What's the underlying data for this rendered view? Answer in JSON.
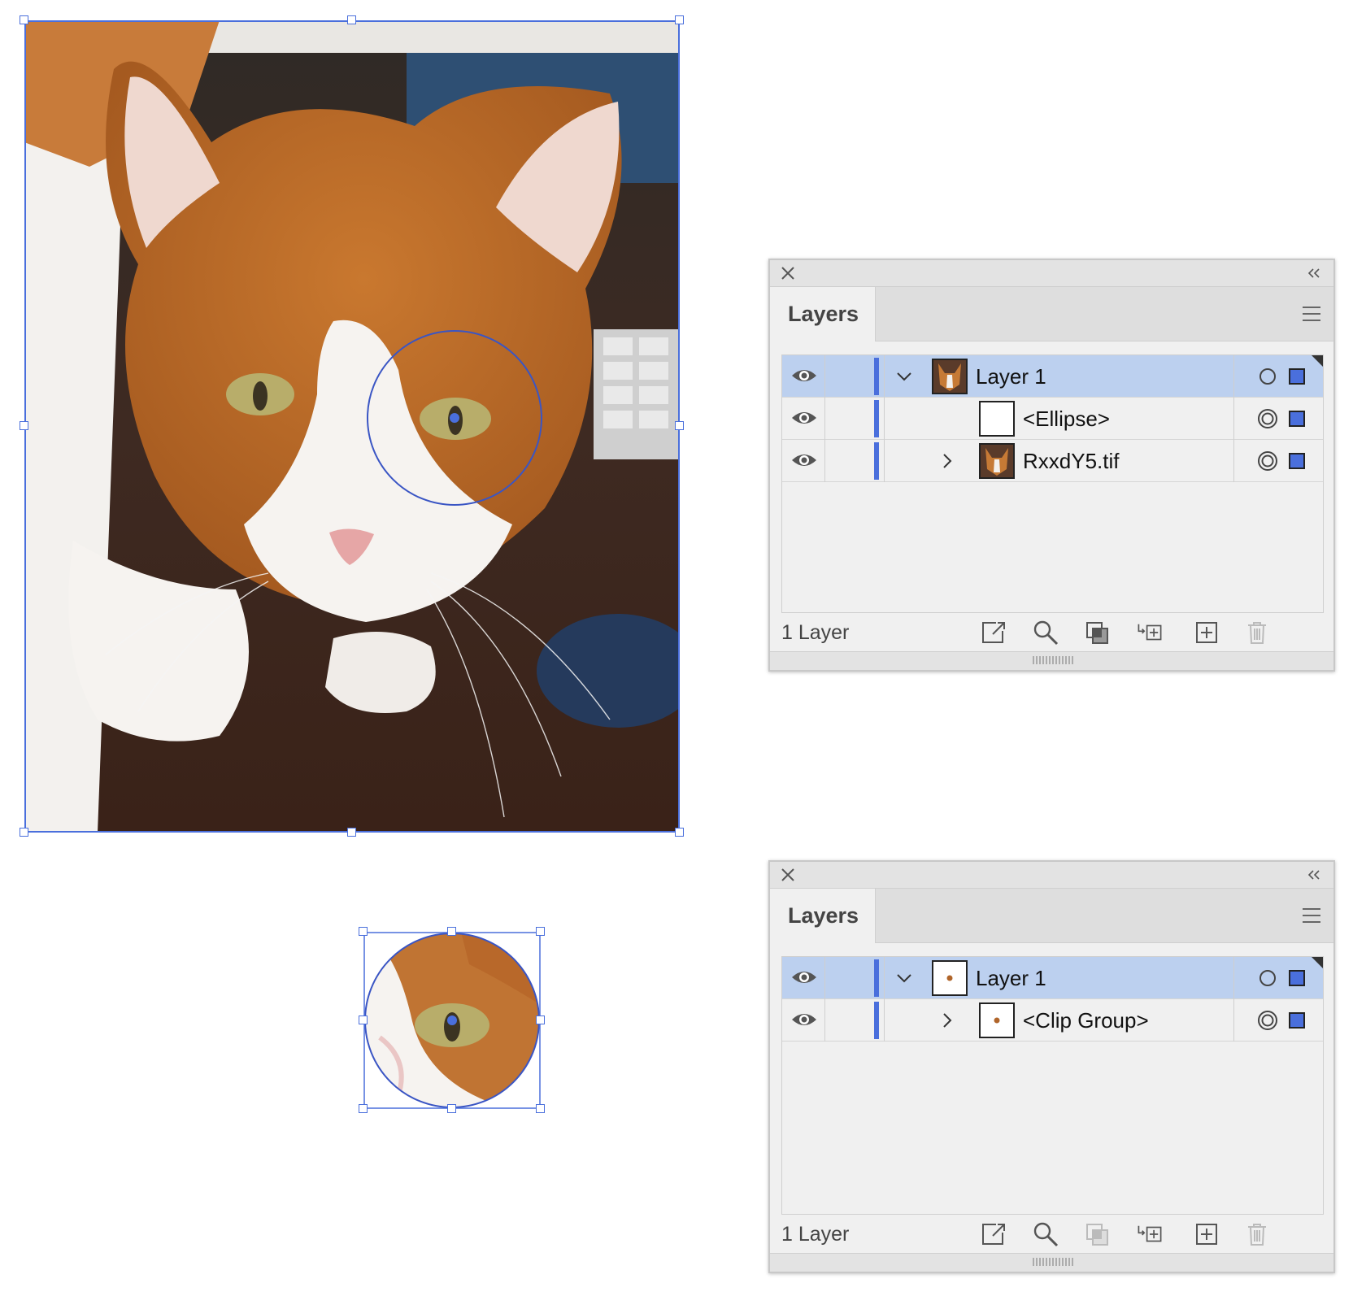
{
  "colors": {
    "selection": "#4a6fdc",
    "row_selected": "#bcd0ef",
    "panel_bg": "#f0f0f0",
    "icon": "#444444"
  },
  "panels": [
    {
      "tab_label": "Layers",
      "rows": [
        {
          "label": "Layer 1",
          "thumb": "cat-thumbnail",
          "selected": true,
          "expanded": true
        },
        {
          "label": "<Ellipse>",
          "thumb": "blank-thumbnail",
          "selected": false
        },
        {
          "label": "RxxdY5.tif",
          "thumb": "cat-thumbnail",
          "selected": false,
          "expanded": false
        }
      ],
      "footer_text": "1 Layer"
    },
    {
      "tab_label": "Layers",
      "rows": [
        {
          "label": "Layer 1",
          "thumb": "dot-thumbnail",
          "selected": true,
          "expanded": true
        },
        {
          "label": "<Clip Group>",
          "thumb": "dot-thumbnail",
          "selected": false,
          "expanded": false
        }
      ],
      "footer_text": "1 Layer"
    }
  ],
  "icons": {
    "close": "close-icon",
    "collapse": "double-chevron-left-icon",
    "menu": "panel-menu-icon",
    "visibility": "eye-icon",
    "target": "target-circle-icon",
    "selection": "selection-square-icon",
    "footer": [
      "export-icon",
      "locate-object-icon",
      "make-clipping-mask-icon",
      "create-sublayer-icon",
      "new-layer-icon",
      "trash-icon"
    ]
  }
}
